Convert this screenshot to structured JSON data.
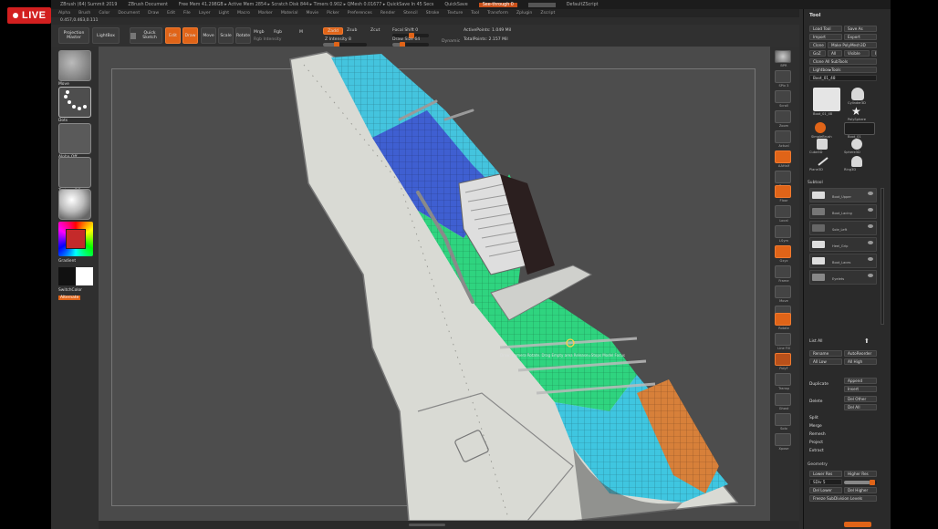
{
  "live_badge": "LIVE",
  "titlebar": {
    "app": "ZBrush (64) Summit 2019",
    "doc": "ZBrush Document",
    "stats": "Free Mem 41.298GB ▸ Active Mem 2854 ▸ Scratch Disk 844 ▸ Timers 0.902 ▸ QMesh 0.01677 ▸ QuickSave In 45 Secs",
    "quicksave": "QuickSave",
    "seethrough": "See-through  0",
    "menus": "Menus",
    "script": "DefaultZScript"
  },
  "menubar": [
    "Alpha",
    "Brush",
    "Color",
    "Document",
    "Draw",
    "Edit",
    "File",
    "Layer",
    "Light",
    "Macro",
    "Marker",
    "Material",
    "Movie",
    "Picker",
    "Preferences",
    "Render",
    "Stencil",
    "Stroke",
    "Texture",
    "Tool",
    "Transform",
    "Zplugin",
    "Zscript"
  ],
  "coordinates": "0.457,0.463,0.111",
  "toolbar": {
    "projection_master": "Projection Master",
    "lightbox": "LightBox",
    "quick_sketch": "Quick Sketch",
    "edit": "Edit",
    "draw": "Draw",
    "move": "Move",
    "scale": "Scale",
    "rotate": "Rotate",
    "mrgb": "Mrgb",
    "rgb": "Rgb",
    "m": "M",
    "zadd": "Zadd",
    "zsub": "Zsub",
    "zcut": "Zcut",
    "rgb_intensity": "Rgb Intensity",
    "z_intensity": "Z Intensity 8",
    "focal_shift": "Focal Shift 0",
    "draw_size": "Draw Size 64",
    "dynamic": "Dynamic",
    "active_points": "ActivePoints: 1.049 Mil",
    "total_points": "TotalPoints: 2.157 Mil"
  },
  "leftshelf": {
    "brush_label": "Move",
    "stroke_label": "Dots",
    "alpha_label": "Alpha Off",
    "texture_label": "Texture Off",
    "material_label": "MatCap",
    "gradient": "Gradient",
    "switch_color": "SwitchColor",
    "alternate": "Alternate"
  },
  "viewport": {
    "overlay_text": "Draw: Camera Rotate. Drag Empty area Release=Stops Model Focus"
  },
  "rightshelf": [
    "BPR",
    "SPix 3",
    "Scroll",
    "Zoom",
    "Actual",
    "AAHalf",
    "Persp",
    "Floor",
    "Local",
    "LSym",
    "Gxyz",
    "Frame",
    "Move",
    "Scale",
    "Rotate",
    "Line Fill",
    "PolyF",
    "Transp",
    "Ghost",
    "Solo",
    "Xpose"
  ],
  "tool": {
    "title": "Tool",
    "load_tool": "Load Tool",
    "save_as": "Save As",
    "import": "Import",
    "export": "Export",
    "clone": "Clone",
    "make_polymesh": "Make PolyMesh3D",
    "goz": "GoZ",
    "all": "All",
    "visible": "Visible",
    "r": "R",
    "clone_all_subtools": "Clone All SubTools",
    "lightbox_tools": "Lightbox▸Tools",
    "current_tool": "Boot_01_48",
    "thumbs": [
      "Boot_01_48",
      "Cylinder3D",
      "PolySphere",
      "SimpleBrush",
      "Boot_01",
      "Cube3D",
      "Sphere3D",
      "Plane3D",
      "Ring3D",
      "PolyMesh3D"
    ],
    "subtool_head": "Subtool",
    "subtools": [
      "Boot_Upper",
      "Boot_Lacing",
      "Sole_Left",
      "Heel_Grip",
      "Boot_Laces",
      "Eyelets"
    ],
    "list_all": "List All",
    "rename": "Rename",
    "auto_reorder": "AutoReorder",
    "all_low": "All Low",
    "all_high": "All High",
    "duplicate": "Duplicate",
    "append": "Append",
    "insert": "Insert",
    "delete": "Delete",
    "del_other": "Del Other",
    "del_all": "Del All",
    "split": "Split",
    "merge": "Merge",
    "remesh": "Remesh",
    "project": "Project",
    "extract": "Extract",
    "geometry_head": "Geometry",
    "lower_res": "Lower Res",
    "higher_res": "Higher Res",
    "sdiv": "SDiv 5",
    "del_lower": "Del Lower",
    "del_higher": "Del Higher",
    "freeze_subdiv": "Freeze SubDivision Levels"
  }
}
